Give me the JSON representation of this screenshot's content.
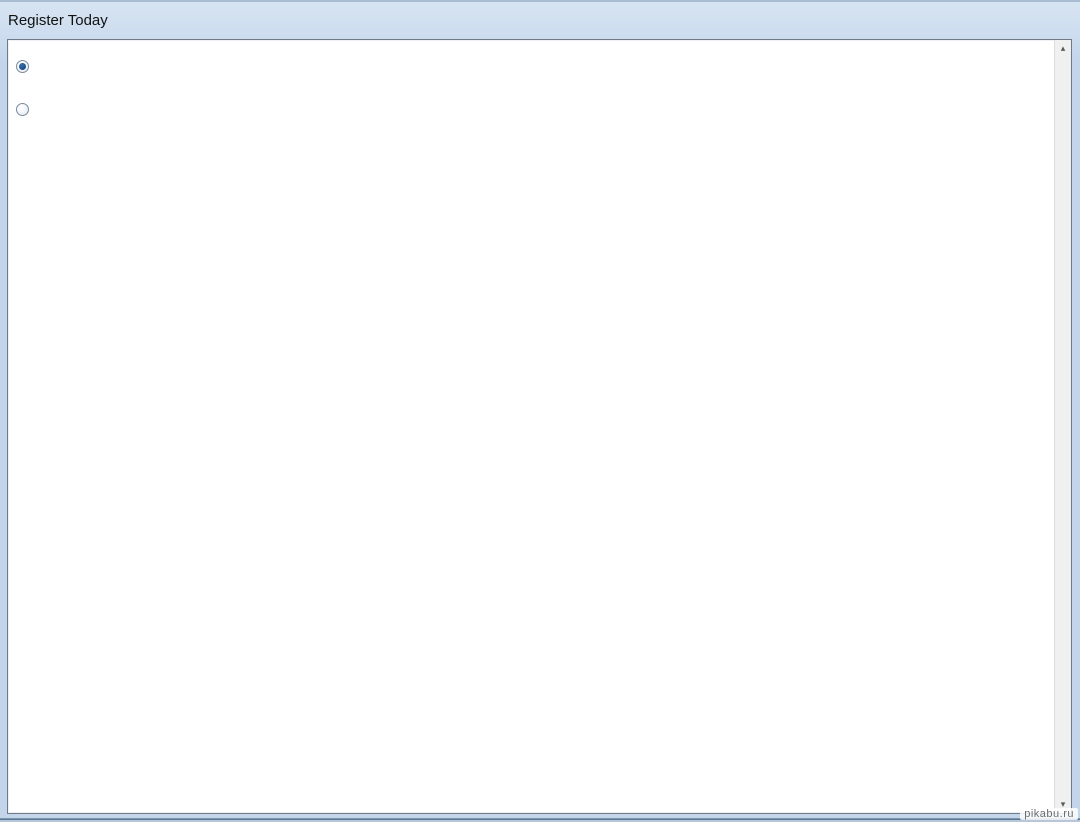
{
  "window": {
    "title": "Register Today"
  },
  "options": [
    {
      "label": "",
      "checked": true
    },
    {
      "label": "",
      "checked": false
    }
  ],
  "scrollbar": {
    "up_glyph": "▴",
    "down_glyph": "▾"
  },
  "watermark": "pikabu.ru"
}
